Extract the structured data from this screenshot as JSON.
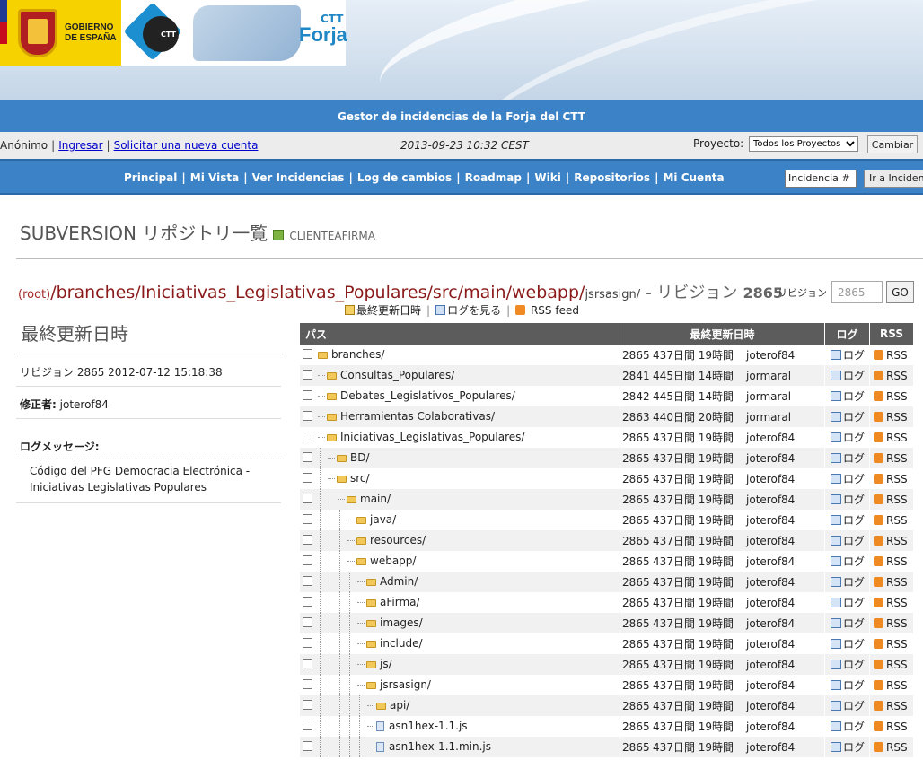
{
  "header": {
    "gov_text": [
      "GOBIERNO",
      "DE ESPAÑA"
    ],
    "ctt_logo_text": "CTT",
    "forja_small": "CTT",
    "forja_big": "Forja",
    "title": "Gestor de incidencias de la Forja del CTT"
  },
  "userbar": {
    "user": "Anónimo",
    "login": "Ingresar",
    "signup": "Solicitar una nueva cuenta",
    "datetime": "2013-09-23 10:32 CEST",
    "project_label": "Proyecto:",
    "project_value": "Todos los Proyectos",
    "change_button": "Cambiar"
  },
  "nav": {
    "items": [
      "Principal",
      "Mi Vista",
      "Ver Incidencias",
      "Log de cambios",
      "Roadmap",
      "Wiki",
      "Repositorios",
      "Mi Cuenta"
    ],
    "issue_placeholder": "Incidencia #",
    "go_button": "Ir a Incidencia"
  },
  "page": {
    "title": "SUBVERSION リポジトリ一覧",
    "project": "CLIENTEAFIRMA"
  },
  "breadcrumb": {
    "root": "(root)",
    "parts": [
      "branches",
      "Iniciativas_Legislativas_Populares",
      "src",
      "main",
      "webapp"
    ],
    "current": "jsrsasign/",
    "revision_text": "- リビジョン",
    "revision_number": "2865",
    "revision_label": "リビジョン",
    "revision_input": "2865",
    "go": "GO"
  },
  "toolbar": {
    "last_modified": "最終更新日時",
    "view_log": "ログを見る",
    "rss": "RSS feed"
  },
  "sidebar": {
    "heading": "最終更新日時",
    "revision_line": "リビジョン 2865 2012-07-12 15:18:38",
    "author_label": "修正者:",
    "author": "joterof84",
    "log_heading": "ログメッセージ:",
    "log_message": "Código del PFG Democracia Electrónica - Iniciativas Legislativas Populares"
  },
  "table": {
    "headers": {
      "path": "パス",
      "modified": "最終更新日時",
      "log": "ログ",
      "rss": "RSS"
    },
    "log_label": "ログ",
    "rss_label": "RSS",
    "rows": [
      {
        "name": "branches/",
        "depth": 0,
        "type": "folder",
        "rev": "2865",
        "age": "437日間 19時間",
        "author": "joterof84"
      },
      {
        "name": "Consultas_Populares/",
        "depth": 1,
        "type": "folder",
        "rev": "2841",
        "age": "445日間 14時間",
        "author": "jormaral"
      },
      {
        "name": "Debates_Legislativos_Populares/",
        "depth": 1,
        "type": "folder",
        "rev": "2842",
        "age": "445日間 14時間",
        "author": "jormaral"
      },
      {
        "name": "Herramientas Colaborativas/",
        "depth": 1,
        "type": "folder",
        "rev": "2863",
        "age": "440日間 20時間",
        "author": "jormaral"
      },
      {
        "name": "Iniciativas_Legislativas_Populares/",
        "depth": 1,
        "type": "folder",
        "rev": "2865",
        "age": "437日間 19時間",
        "author": "joterof84"
      },
      {
        "name": "BD/",
        "depth": 2,
        "type": "folder",
        "rev": "2865",
        "age": "437日間 19時間",
        "author": "joterof84"
      },
      {
        "name": "src/",
        "depth": 2,
        "type": "folder",
        "rev": "2865",
        "age": "437日間 19時間",
        "author": "joterof84"
      },
      {
        "name": "main/",
        "depth": 3,
        "type": "folder",
        "rev": "2865",
        "age": "437日間 19時間",
        "author": "joterof84"
      },
      {
        "name": "java/",
        "depth": 4,
        "type": "folder",
        "rev": "2865",
        "age": "437日間 19時間",
        "author": "joterof84"
      },
      {
        "name": "resources/",
        "depth": 4,
        "type": "folder",
        "rev": "2865",
        "age": "437日間 19時間",
        "author": "joterof84"
      },
      {
        "name": "webapp/",
        "depth": 4,
        "type": "folder",
        "rev": "2865",
        "age": "437日間 19時間",
        "author": "joterof84"
      },
      {
        "name": "Admin/",
        "depth": 5,
        "type": "folder",
        "rev": "2865",
        "age": "437日間 19時間",
        "author": "joterof84"
      },
      {
        "name": "aFirma/",
        "depth": 5,
        "type": "folder",
        "rev": "2865",
        "age": "437日間 19時間",
        "author": "joterof84"
      },
      {
        "name": "images/",
        "depth": 5,
        "type": "folder",
        "rev": "2865",
        "age": "437日間 19時間",
        "author": "joterof84"
      },
      {
        "name": "include/",
        "depth": 5,
        "type": "folder",
        "rev": "2865",
        "age": "437日間 19時間",
        "author": "joterof84"
      },
      {
        "name": "js/",
        "depth": 5,
        "type": "folder",
        "rev": "2865",
        "age": "437日間 19時間",
        "author": "joterof84"
      },
      {
        "name": "jsrsasign/",
        "depth": 5,
        "type": "folder",
        "rev": "2865",
        "age": "437日間 19時間",
        "author": "joterof84"
      },
      {
        "name": "api/",
        "depth": 6,
        "type": "folder",
        "rev": "2865",
        "age": "437日間 19時間",
        "author": "joterof84"
      },
      {
        "name": "asn1hex-1.1.js",
        "depth": 6,
        "type": "file",
        "rev": "2865",
        "age": "437日間 19時間",
        "author": "joterof84"
      },
      {
        "name": "asn1hex-1.1.min.js",
        "depth": 6,
        "type": "file",
        "rev": "2865",
        "age": "437日間 19時間",
        "author": "joterof84"
      }
    ]
  }
}
